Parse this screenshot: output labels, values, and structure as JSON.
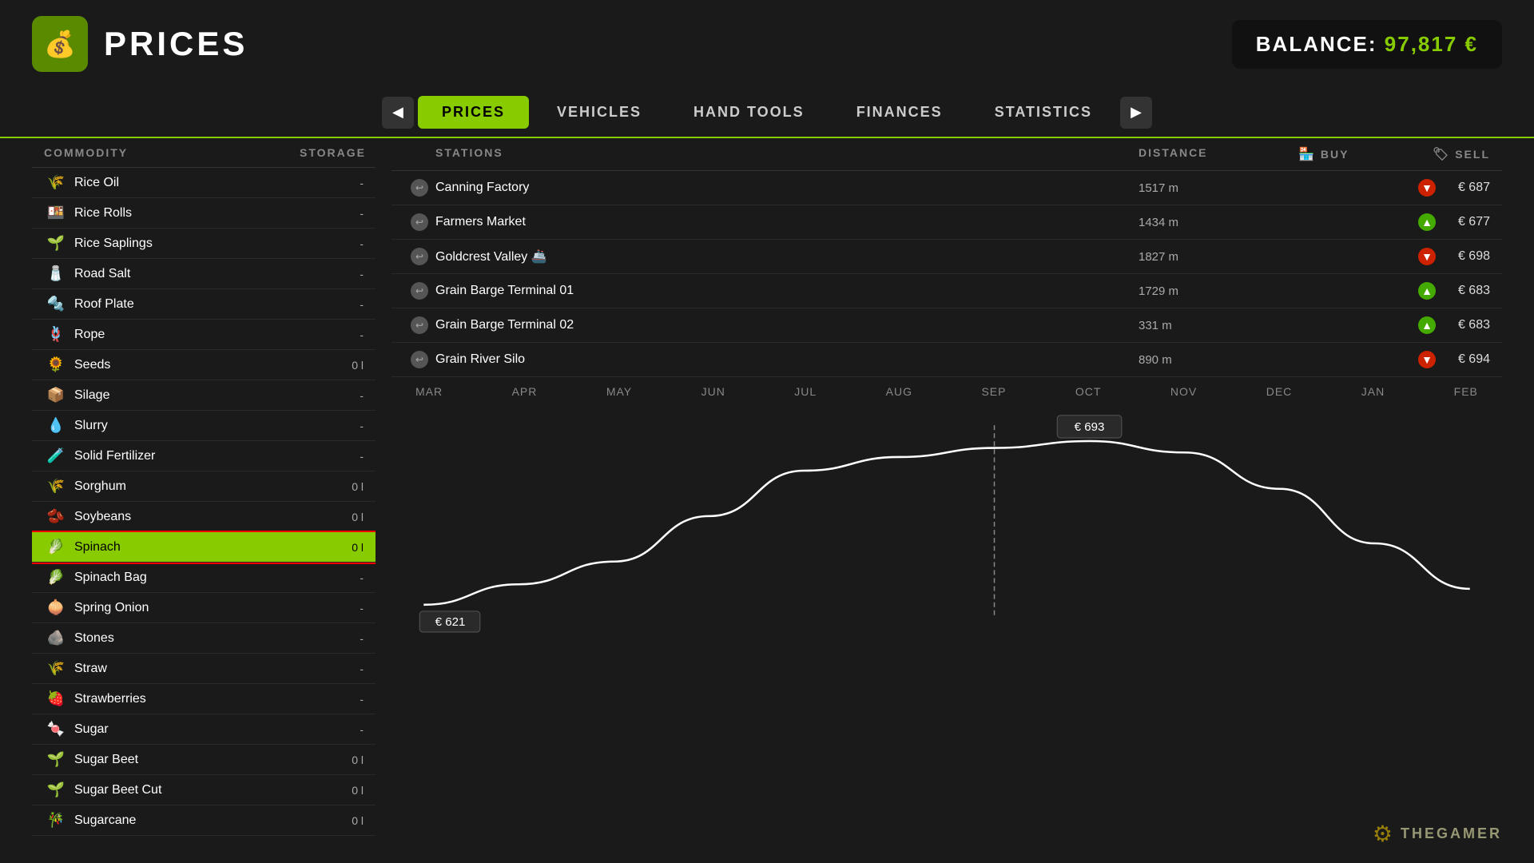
{
  "header": {
    "icon": "💰",
    "title": "PRICES",
    "balance_label": "BALANCE:",
    "balance_value": "97,817 €"
  },
  "nav": {
    "prev_arrow": "◀",
    "next_arrow": "▶",
    "tabs": [
      {
        "label": "PRICES",
        "active": true
      },
      {
        "label": "VEHICLES",
        "active": false
      },
      {
        "label": "HAND TOOLS",
        "active": false
      },
      {
        "label": "FINANCES",
        "active": false
      },
      {
        "label": "STATISTICS",
        "active": false
      }
    ]
  },
  "table_headers": {
    "commodity": "COMMODITY",
    "storage": "STORAGE",
    "stations": "STATIONS",
    "distance": "DISTANCE",
    "buy": "BUY",
    "sell": "SELL"
  },
  "commodities": [
    {
      "icon": "🌾",
      "name": "Rice Oil",
      "storage": "-",
      "selected": false
    },
    {
      "icon": "🍱",
      "name": "Rice Rolls",
      "storage": "-",
      "selected": false
    },
    {
      "icon": "🌱",
      "name": "Rice Saplings",
      "storage": "-",
      "selected": false
    },
    {
      "icon": "🧂",
      "name": "Road Salt",
      "storage": "-",
      "selected": false
    },
    {
      "icon": "🔩",
      "name": "Roof Plate",
      "storage": "-",
      "selected": false
    },
    {
      "icon": "🪢",
      "name": "Rope",
      "storage": "-",
      "selected": false
    },
    {
      "icon": "🌻",
      "name": "Seeds",
      "storage": "0 l",
      "selected": false
    },
    {
      "icon": "📦",
      "name": "Silage",
      "storage": "-",
      "selected": false
    },
    {
      "icon": "💧",
      "name": "Slurry",
      "storage": "-",
      "selected": false
    },
    {
      "icon": "🧪",
      "name": "Solid Fertilizer",
      "storage": "-",
      "selected": false
    },
    {
      "icon": "🌾",
      "name": "Sorghum",
      "storage": "0 l",
      "selected": false
    },
    {
      "icon": "🫘",
      "name": "Soybeans",
      "storage": "0 l",
      "selected": false
    },
    {
      "icon": "🥬",
      "name": "Spinach",
      "storage": "0 l",
      "selected": true
    },
    {
      "icon": "🥬",
      "name": "Spinach Bag",
      "storage": "-",
      "selected": false
    },
    {
      "icon": "🧅",
      "name": "Spring Onion",
      "storage": "-",
      "selected": false
    },
    {
      "icon": "🪨",
      "name": "Stones",
      "storage": "-",
      "selected": false
    },
    {
      "icon": "🌾",
      "name": "Straw",
      "storage": "-",
      "selected": false
    },
    {
      "icon": "🍓",
      "name": "Strawberries",
      "storage": "-",
      "selected": false
    },
    {
      "icon": "🍬",
      "name": "Sugar",
      "storage": "-",
      "selected": false
    },
    {
      "icon": "🌱",
      "name": "Sugar Beet",
      "storage": "0 l",
      "selected": false
    },
    {
      "icon": "🌱",
      "name": "Sugar Beet Cut",
      "storage": "0 l",
      "selected": false
    },
    {
      "icon": "🎋",
      "name": "Sugarcane",
      "storage": "0 l",
      "selected": false
    }
  ],
  "stations": [
    {
      "name": "Canning Factory",
      "distance": "1517 m",
      "direction": "nav",
      "indicator": "down",
      "price": "€ 687"
    },
    {
      "name": "Farmers Market",
      "distance": "1434 m",
      "direction": "nav",
      "indicator": "up",
      "price": "€ 677"
    },
    {
      "name": "Goldcrest Valley",
      "distance": "1827 m",
      "direction": "nav",
      "has_extra": true,
      "indicator": "down",
      "price": "€ 698"
    },
    {
      "name": "Grain Barge Terminal 01",
      "distance": "1729 m",
      "direction": "nav",
      "indicator": "up",
      "price": "€ 683"
    },
    {
      "name": "Grain Barge Terminal 02",
      "distance": "331 m",
      "direction": "nav",
      "indicator": "up",
      "price": "€ 683"
    },
    {
      "name": "Grain River Silo",
      "distance": "890 m",
      "direction": "nav",
      "indicator": "down",
      "price": "€ 694"
    }
  ],
  "chart": {
    "months": [
      "MAR",
      "APR",
      "MAY",
      "JUN",
      "JUL",
      "AUG",
      "SEP",
      "OCT",
      "NOV",
      "DEC",
      "JAN",
      "FEB"
    ],
    "tooltip_value": "€ 693",
    "tooltip_month": "OCT",
    "min_label": "€ 621",
    "active_month": "SEP",
    "points": [
      {
        "month": "MAR",
        "value": 621
      },
      {
        "month": "APR",
        "value": 630
      },
      {
        "month": "MAY",
        "value": 640
      },
      {
        "month": "JUN",
        "value": 660
      },
      {
        "month": "JUL",
        "value": 680
      },
      {
        "month": "AUG",
        "value": 686
      },
      {
        "month": "SEP",
        "value": 690
      },
      {
        "month": "OCT",
        "value": 693
      },
      {
        "month": "NOV",
        "value": 688
      },
      {
        "month": "DEC",
        "value": 672
      },
      {
        "month": "JAN",
        "value": 648
      },
      {
        "month": "FEB",
        "value": 628
      }
    ]
  },
  "watermark": {
    "text": "THEGAMER",
    "icon": "⚙"
  }
}
